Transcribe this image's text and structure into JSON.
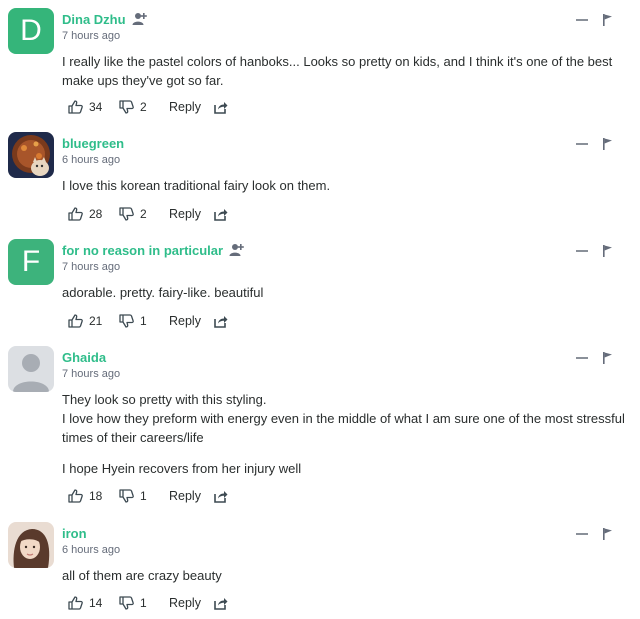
{
  "colors": {
    "author": "#2fbd8a",
    "text": "#2a2e2e",
    "meta": "#656c7a",
    "avatar_d": "#35b57a",
    "avatar_f": "#3db37c"
  },
  "comments": [
    {
      "author": "Dina Dzhu",
      "time": "7 hours ago",
      "avatar_letter": "D",
      "has_follow_icon": true,
      "body": [
        "I really like the pastel colors of hanboks... Looks so pretty on kids, and I think it's one of the best make ups they've got so far."
      ],
      "upvotes": "34",
      "downvotes": "2",
      "reply_label": "Reply"
    },
    {
      "author": "bluegreen",
      "time": "6 hours ago",
      "avatar_letter": "",
      "has_follow_icon": false,
      "body": [
        "I love this korean traditional fairy look on them."
      ],
      "upvotes": "28",
      "downvotes": "2",
      "reply_label": "Reply"
    },
    {
      "author": "for no reason in particular",
      "time": "7 hours ago",
      "avatar_letter": "F",
      "has_follow_icon": true,
      "body": [
        "adorable. pretty. fairy-like. beautiful"
      ],
      "upvotes": "21",
      "downvotes": "1",
      "reply_label": "Reply"
    },
    {
      "author": "Ghaida",
      "time": "7 hours ago",
      "avatar_letter": "",
      "has_follow_icon": false,
      "body": [
        "They look so pretty with this styling.",
        "I love how they preform with energy even in the middle of what I am sure one of the most stressful times of their careers/life",
        "I hope Hyein recovers from her injury well"
      ],
      "upvotes": "18",
      "downvotes": "1",
      "reply_label": "Reply"
    },
    {
      "author": "iron",
      "time": "6 hours ago",
      "avatar_letter": "",
      "has_follow_icon": false,
      "body": [
        "all of them are crazy beauty"
      ],
      "upvotes": "14",
      "downvotes": "1",
      "reply_label": "Reply"
    }
  ]
}
